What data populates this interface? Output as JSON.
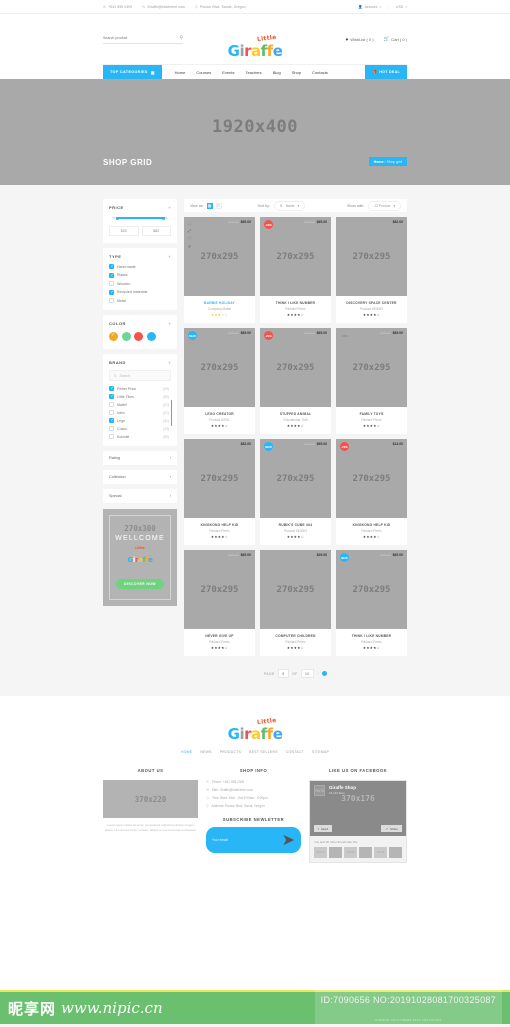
{
  "topbar": {
    "phone": "+541 595 0309",
    "mail": "Giraffe@toistheme.com",
    "address": "Proctor Blvd, Sands, Oregon",
    "account": "Account",
    "currency": "USD",
    "separator": "|"
  },
  "header": {
    "search_placeholder": "Search product",
    "logo_little": "Little",
    "logo_letters": [
      "G",
      "i",
      "r",
      "a",
      "f",
      "f",
      "e",
      ""
    ],
    "wishlist": "WishList ( 0 )",
    "cart": "Cart ( 0 )"
  },
  "nav": {
    "top_categories": "TOP CATEGORIES",
    "links": [
      "Home",
      "Courses",
      "Events",
      "Teachers",
      "Blog",
      "Shop",
      "Contacts"
    ],
    "hot_deal": "HOT DEAL"
  },
  "hero": {
    "dimension": "1920x400",
    "title": "SHOP GRID",
    "breadcrumb_home": "Home",
    "breadcrumb_sep": " / ",
    "breadcrumb_current": "Shop grid"
  },
  "sidebar": {
    "price": {
      "title": "PRICE",
      "min": "$20",
      "max": "$82"
    },
    "type": {
      "title": "TYPE",
      "options": [
        {
          "label": "Hand made",
          "checked": true
        },
        {
          "label": "Plastic",
          "checked": true
        },
        {
          "label": "Wooden",
          "checked": false
        },
        {
          "label": "Recycled materials",
          "checked": true
        },
        {
          "label": "Metal",
          "checked": false
        }
      ]
    },
    "color": {
      "title": "COLOR",
      "swatches": [
        "#f5a623",
        "#6dd49a",
        "#f4524d",
        "#29b6f6"
      ],
      "selected_index": 0
    },
    "brand": {
      "title": "BRAND",
      "search_placeholder": "Search",
      "options": [
        {
          "label": "Fisher Price",
          "count": "(29)",
          "checked": true
        },
        {
          "label": "Little Tikes",
          "count": "(92)",
          "checked": true
        },
        {
          "label": "Mattel",
          "count": "(21)",
          "checked": false
        },
        {
          "label": "Intex",
          "count": "(21)",
          "checked": false
        },
        {
          "label": "Lego",
          "count": "(31)",
          "checked": true
        },
        {
          "label": "Cosco",
          "count": "(23)",
          "checked": false
        },
        {
          "label": "Kolcraft",
          "count": "(92)",
          "checked": false
        }
      ]
    },
    "accordions": [
      "Rating",
      "Collection",
      "Special"
    ],
    "promo": {
      "dimension": "270x300",
      "welcome": "WELLCOME",
      "logo_little": "Little",
      "logo_letters": [
        "G",
        "i",
        "r",
        "a",
        "f",
        "f",
        "e"
      ],
      "button": "DISCOVER NOW"
    }
  },
  "toolbar": {
    "view_as": "View as:",
    "sort_by": "Sort by:",
    "sort_value": "Name",
    "show_with": "Show with:",
    "show_value": "12 Product"
  },
  "products": [
    {
      "dimension": "270x295",
      "old_price": "$75.00",
      "price": "$65.00",
      "badge": "",
      "badge_type": "",
      "name": "BARBIE HOLIDAY",
      "author": "Company Mattel",
      "stars": "★★★☆☆",
      "gold": true,
      "highlight": true,
      "hover": true
    },
    {
      "dimension": "270x295",
      "old_price": "$65.00",
      "price": "$65.00",
      "badge": "-20%",
      "badge_type": "sale",
      "name": "THINK I LIKE NUMBER",
      "author": "Richard Perez",
      "stars": "★★★★☆",
      "gold": false,
      "highlight": false,
      "hover": false
    },
    {
      "dimension": "270x295",
      "old_price": "",
      "price": "$82.00",
      "badge": "",
      "badge_type": "",
      "name": "DISCOVERY SPACE CENTER",
      "author": "Product #E3003",
      "stars": "★★★★☆",
      "gold": false,
      "highlight": false,
      "hover": false
    },
    {
      "dimension": "270x295",
      "old_price": "$65.00",
      "price": "$65.00",
      "badge": "NEW",
      "badge_type": "new",
      "name": "LEGO CREATOR",
      "author": "Product #2911",
      "stars": "★★★★☆",
      "gold": false,
      "highlight": false,
      "hover": false
    },
    {
      "dimension": "270x295",
      "old_price": "$65.00",
      "price": "$65.00",
      "badge": "-20%",
      "badge_type": "sale",
      "name": "STUFFED ANIMAL",
      "author": "Educational, Soft",
      "stars": "★★★★☆",
      "gold": false,
      "highlight": false,
      "hover": false
    },
    {
      "dimension": "270x295",
      "old_price": "$65.00",
      "price": "$65.00",
      "badge": "-20%",
      "badge_type": "flat",
      "name": "FAMILY TOYS",
      "author": "Richard Perez",
      "stars": "★★★★☆",
      "gold": false,
      "highlight": false,
      "hover": false
    },
    {
      "dimension": "270x295",
      "old_price": "",
      "price": "$82.00",
      "badge": "",
      "badge_type": "",
      "name": "KINGKONG HELP KID",
      "author": "Richard Perez",
      "stars": "★★★★☆",
      "gold": false,
      "highlight": false,
      "hover": false
    },
    {
      "dimension": "270x295",
      "old_price": "$65.00",
      "price": "$65.00",
      "badge": "NEW",
      "badge_type": "new",
      "name": "RUBIK'S CUBE 4X4",
      "author": "Product #E3003",
      "stars": "★★★★☆",
      "gold": false,
      "highlight": false,
      "hover": false
    },
    {
      "dimension": "270x295",
      "old_price": "",
      "price": "$13.00",
      "badge": "-20%",
      "badge_type": "sale",
      "name": "KINGKONG HELP KID",
      "author": "Richard Perez",
      "stars": "★★★★☆",
      "gold": false,
      "highlight": false,
      "hover": false
    },
    {
      "dimension": "270x295",
      "old_price": "$75.00",
      "price": "$65.00",
      "badge": "",
      "badge_type": "",
      "name": "NEVER GIVE UP",
      "author": "Richard Perez",
      "stars": "★★★★☆",
      "gold": false,
      "highlight": false,
      "hover": false
    },
    {
      "dimension": "270x295",
      "old_price": "",
      "price": "$29.00",
      "badge": "",
      "badge_type": "",
      "name": "COMPUTER CHILDREN",
      "author": "Richard Perez",
      "stars": "★★★★☆",
      "gold": false,
      "highlight": false,
      "hover": false
    },
    {
      "dimension": "270x295",
      "old_price": "$65.00",
      "price": "$65.00",
      "badge": "NEW",
      "badge_type": "new",
      "name": "THINK I LIKE NUMBER",
      "author": "Richard Perez",
      "stars": "★★★★☆",
      "gold": false,
      "highlight": false,
      "hover": false
    }
  ],
  "pagination": {
    "label": "PAGE",
    "current": "5",
    "of": "OF",
    "total": "10"
  },
  "footer": {
    "logo_little": "Little",
    "logo_letters": [
      "G",
      "i",
      "r",
      "a",
      "f",
      "f",
      "e",
      ""
    ],
    "nav": [
      "HOME",
      "NEWS",
      "PRODUCTS",
      "BEST SELLERS",
      "CONTACT",
      "SITEMAP"
    ],
    "about": {
      "title": "ABOUT US",
      "dimension": "370x220",
      "text": "Lorem ipsum dolor sit amet, consectetur adipiscing dolore magna aliqua. Ut enim ad minim veniam, aliquip ex ea commodo consequat."
    },
    "shop_info": {
      "title": "SHOP INFO",
      "rows": [
        {
          "icon": "phone-icon",
          "glyph": "✆",
          "text": "Phone: +541 595 0309"
        },
        {
          "icon": "mail-icon",
          "glyph": "✉",
          "text": "Mail: Giraffe@toistheme.com"
        },
        {
          "icon": "clock-icon",
          "glyph": "◷",
          "text": "Time Work: Mon - Sat  9:00am - 6:00pm"
        },
        {
          "icon": "pin-icon",
          "glyph": "⚲",
          "text": "Address: Proctor Blvd, Sandi, Oregon"
        }
      ],
      "newsletter_title": "SUBSCRIBE NEWLETTER",
      "email_placeholder": "Your email"
    },
    "facebook": {
      "title": "LIKE US ON FACEBOOK",
      "avatar_dim": "76x76",
      "page_name": "Giraffe Shop",
      "likes": "16,113 likes",
      "dimension": "370x176",
      "liked_button": "Liked",
      "share_button": "Share",
      "friends_text": "You and 36 other friends like this",
      "face_dim": "46x46"
    }
  },
  "watermark": {
    "cn": "昵享网",
    "url": "www.nipic.cn",
    "id": "ID:7090656 NO:20191028081700325087",
    "copyright": "GIRAFFE VOLCTHEME 2016 COPYRIGHT"
  }
}
